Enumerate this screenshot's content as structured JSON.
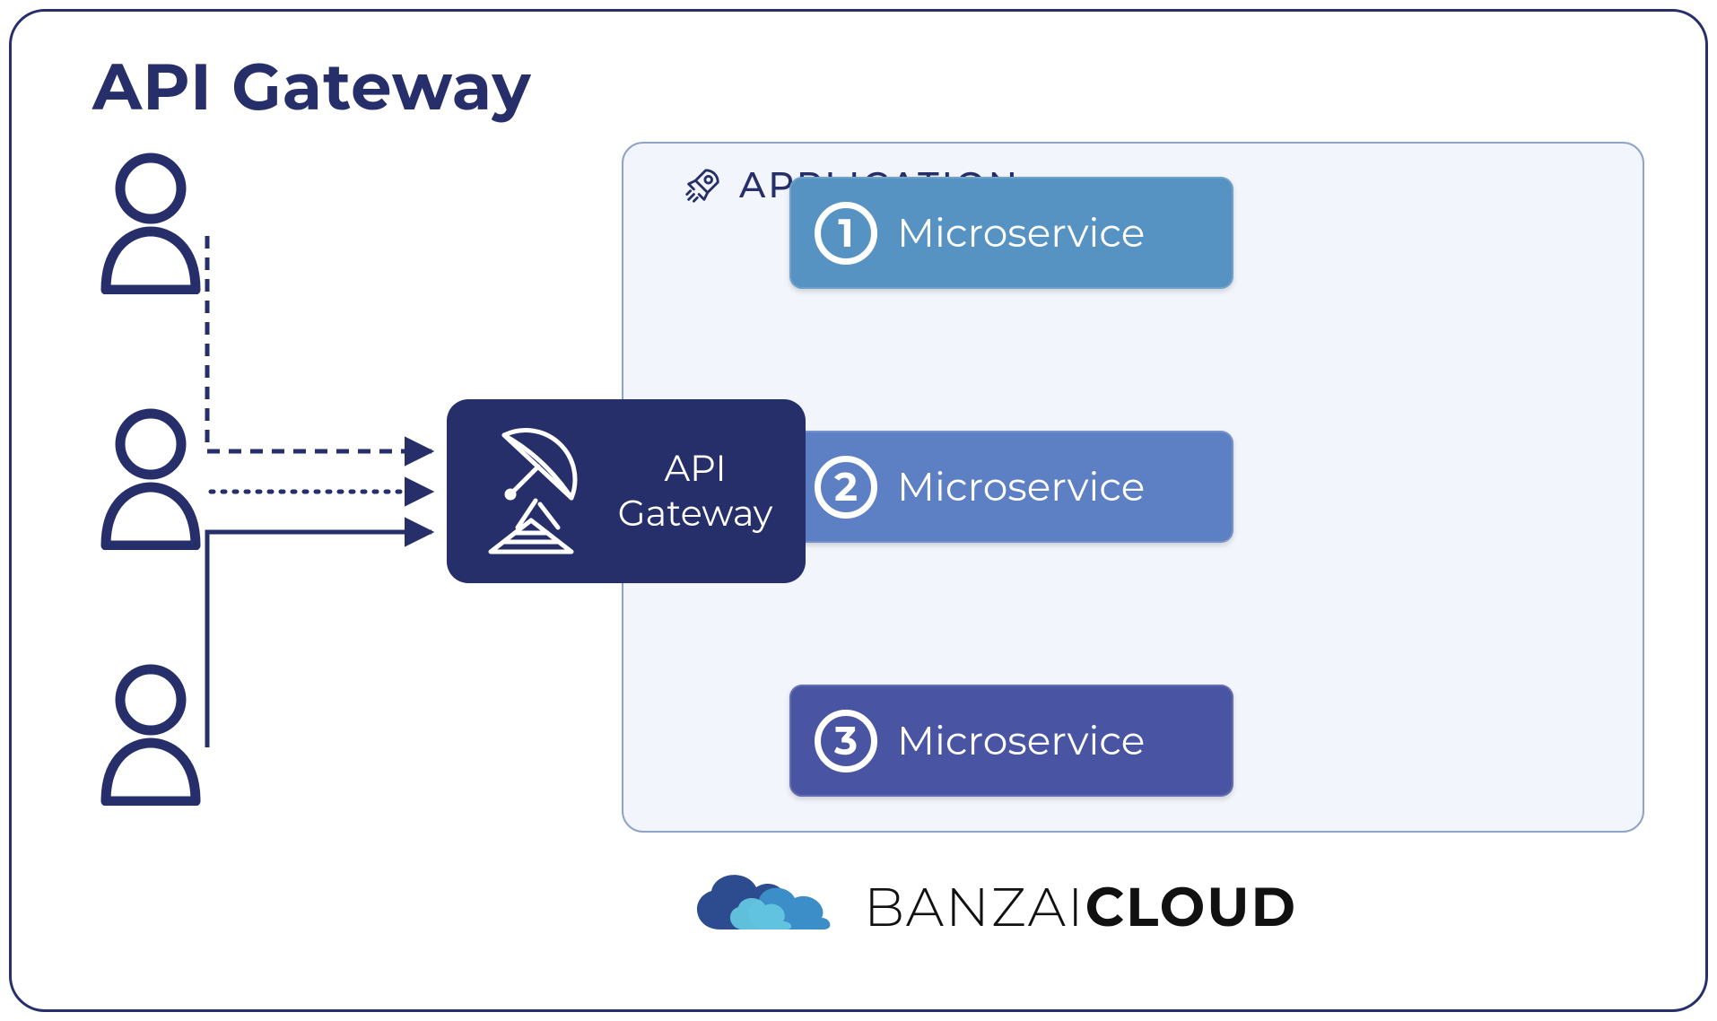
{
  "title": "API Gateway",
  "gateway": {
    "label_line1": "API",
    "label_line2": "Gateway"
  },
  "application": {
    "label": "APPLICATION"
  },
  "microservices": [
    {
      "num": "1",
      "label": "Microservice"
    },
    {
      "num": "2",
      "label": "Microservice"
    },
    {
      "num": "3",
      "label": "Microservice"
    }
  ],
  "branding": {
    "name1": "BANZAI",
    "name2": "CLOUD"
  },
  "colors": {
    "primary": "#262f6a",
    "ms1": "#5693c3",
    "ms2": "#5d7fc3",
    "ms3": "#4955a3",
    "app_bg": "#f2f5fb",
    "teal": "#2f8f9a"
  }
}
